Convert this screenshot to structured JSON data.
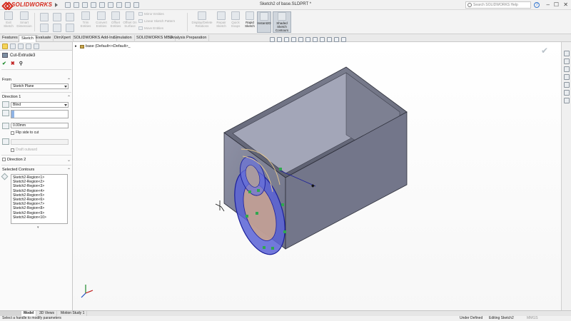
{
  "app": {
    "name": "SOLIDWORKS",
    "doc_title": "Sketch2 of base.SLDPRT *"
  },
  "search": {
    "placeholder": "Search SOLIDWORKS Help"
  },
  "window": {
    "help": "?",
    "minimize": "–",
    "restore": "☐",
    "close": "✕"
  },
  "ribbon": {
    "buttons": [
      "Exit Sketch",
      "Smart Dimension",
      "Trim Entities",
      "Convert Entities",
      "Offset Entities",
      "Offset On Surface",
      "Display/Delete Relations",
      "Repair Sketch",
      "Quick Snaps",
      "Rapid Sketch",
      "Instant2D",
      "Shaded Sketch Contours"
    ],
    "small": [
      "Mirror Entities",
      "Linear Sketch Pattern",
      "Move Entities"
    ]
  },
  "tabs": [
    "Features",
    "Sketch",
    "Evaluate",
    "DimXpert",
    "SOLIDWORKS Add-Ins",
    "Simulation",
    "SOLIDWORKS MBD",
    "Analysis Preparation"
  ],
  "pm": {
    "feature": "Cut-Extrude3",
    "from_header": "From",
    "from_value": "Sketch Plane",
    "dir1_header": "Direction 1",
    "end_condition": "Blind",
    "depth": "0.00mm",
    "flip_side": "Flip side to cut",
    "draft": "Draft outward",
    "dir2_header": "Direction 2",
    "contours_header": "Selected Contours",
    "contours": [
      "Sketch2-Region<1>",
      "Sketch2-Region<2>",
      "Sketch2-Region<3>",
      "Sketch2-Region<4>",
      "Sketch2-Region<5>",
      "Sketch2-Region<6>",
      "Sketch2-Region<7>",
      "Sketch2-Region<8>",
      "Sketch2-Region<9>",
      "Sketch2-Region<10>"
    ]
  },
  "tree": {
    "part": "base",
    "config": "(Default<<Default>_"
  },
  "bottom_tabs": [
    "",
    "Model",
    "3D Views",
    "Motion Study 1"
  ],
  "status": {
    "message": "Select a handle to modify parameters",
    "state": "Under Defined",
    "editing": "Editing Sketch2",
    "units": "MMGS"
  }
}
